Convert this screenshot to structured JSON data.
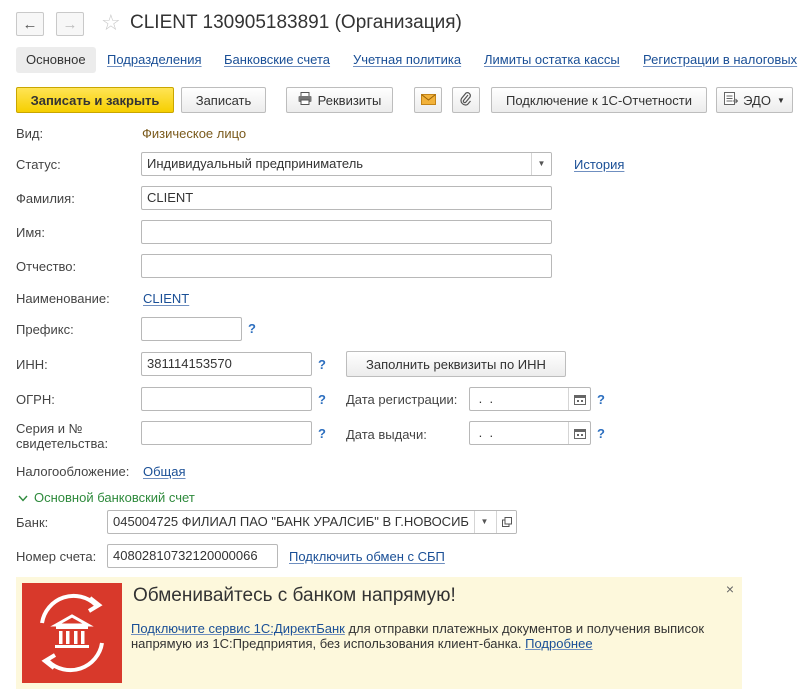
{
  "window": {
    "title": "CLIENT 130905183891 (Организация)"
  },
  "tabs": [
    {
      "label": "Основное"
    },
    {
      "label": "Подразделения"
    },
    {
      "label": "Банковские счета"
    },
    {
      "label": "Учетная политика"
    },
    {
      "label": "Лимиты остатка кассы"
    },
    {
      "label": "Регистрации в налоговых"
    }
  ],
  "toolbar": {
    "save_close": "Записать и закрыть",
    "save": "Записать",
    "requisites": "Реквизиты",
    "connect_reporting": "Подключение к 1С-Отчетности",
    "edo": "ЭДО"
  },
  "form": {
    "vid_label": "Вид:",
    "vid_value": "Физическое лицо",
    "status_label": "Статус:",
    "status_value": "Индивидуальный предприниматель",
    "history_link": "История",
    "surname_label": "Фамилия:",
    "surname_value": "CLIENT",
    "name_label": "Имя:",
    "name_value": "",
    "patronymic_label": "Отчество:",
    "patronymic_value": "",
    "naming_label": "Наименование:",
    "naming_value": "CLIENT",
    "prefix_label": "Префикс:",
    "prefix_value": "",
    "inn_label": "ИНН:",
    "inn_value": "381114153570",
    "fill_by_inn": "Заполнить реквизиты по ИНН",
    "ogrn_label": "ОГРН:",
    "ogrn_value": "",
    "reg_date_label": "Дата регистрации:",
    "reg_date_value": " .  .",
    "series_label_1": "Серия и №",
    "series_label_2": "свидетельства:",
    "series_value": "",
    "issue_date_label": "Дата выдачи:",
    "issue_date_value": " .  .",
    "tax_label": "Налогообложение:",
    "tax_value": "Общая",
    "help": "?"
  },
  "bank_section": {
    "title": "Основной банковский счет",
    "bank_label": "Банк:",
    "bank_value": "045004725 ФИЛИАЛ ПАО \"БАНК УРАЛСИБ\" В Г.НОВОСИБ",
    "account_label": "Номер счета:",
    "account_value": "40802810732120000066",
    "sbp_link": "Подключить обмен с СБП"
  },
  "banner": {
    "heading": "Обменивайтесь с банком напрямую!",
    "link_text": "Подключите сервис 1С:ДиректБанк",
    "text": " для отправки платежных документов и получения выписок напрямую из 1С:Предприятия, без использования клиент-банка. ",
    "more_link": "Подробнее",
    "close": "×"
  },
  "colors": {
    "accent_yellow": "#f6cf00",
    "link_blue": "#1a4f96",
    "banner_bg": "#fdf8dc",
    "bank_icon_red": "#d8392b",
    "section_green": "#2e8a3c"
  }
}
